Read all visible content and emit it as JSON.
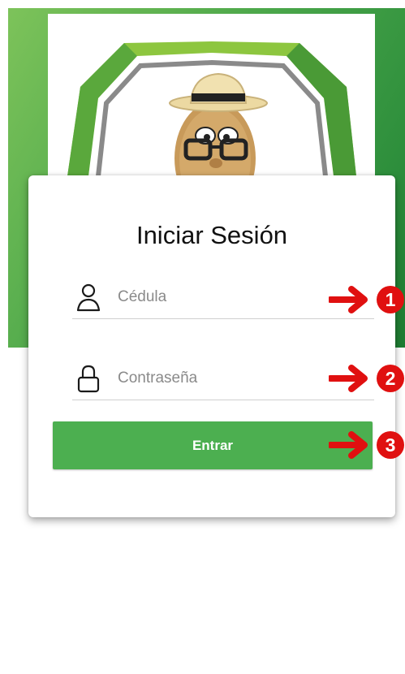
{
  "login": {
    "title": "Iniciar Sesión",
    "username": {
      "placeholder": "Cédula",
      "value": ""
    },
    "password": {
      "placeholder": "Contraseña",
      "value": ""
    },
    "submit_label": "Entrar"
  },
  "callouts": [
    {
      "number": "1"
    },
    {
      "number": "2"
    },
    {
      "number": "3"
    }
  ],
  "colors": {
    "brand_green": "#4caf50",
    "background_green": "#2e8f3c",
    "callout_red": "#e01010"
  },
  "icons": [
    "user-icon",
    "lock-icon",
    "arrow-right-icon"
  ]
}
